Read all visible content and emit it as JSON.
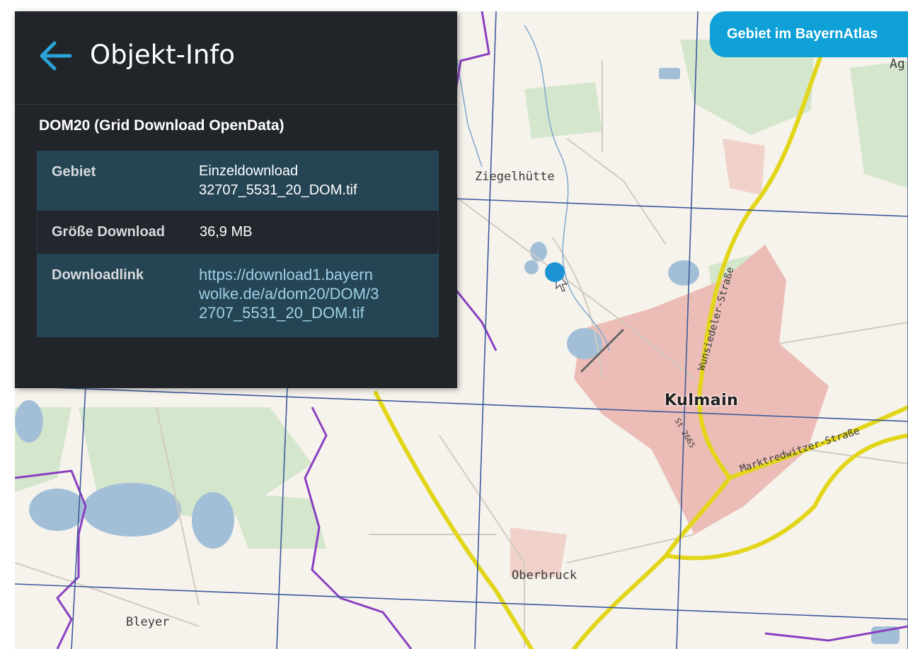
{
  "panel": {
    "title": "Objekt-Info",
    "back_icon": "arrow-left-icon",
    "section_title": "DOM20 (Grid Download OpenData)",
    "rows": [
      {
        "key": "Gebiet",
        "value_line1": "Einzeldownload",
        "value_line2": "32707_5531_20_DOM.tif"
      },
      {
        "key": "Größe Download",
        "value": "36,9 MB"
      },
      {
        "key": "Downloadlink",
        "link_line1": "https://download1.bayern",
        "link_line2": "wolke.de/a/dom20/DOM/3",
        "link_line3": "2707_5531_20_DOM.tif"
      }
    ]
  },
  "area_button": {
    "label": "Gebiet im BayernAtlas"
  },
  "map": {
    "labels": {
      "ziegelhutte": "Ziegelhütte",
      "kulmain": "Kulmain",
      "oberbruck": "Oberbruck",
      "bleyer": "Bleyer",
      "corner": "Ag",
      "wunsiedeler": "Wunsiedeler-Straße",
      "marktredwitzer": "Marktredwitzer-Straße",
      "st": "St 2665"
    },
    "colors": {
      "grid": "#3d5a9a",
      "road": "#f2e52a",
      "boundary": "#8a3fc0",
      "water": "#a9c4dc",
      "settlement": "#e9b9b4",
      "forest": "#cfe2c8"
    }
  }
}
